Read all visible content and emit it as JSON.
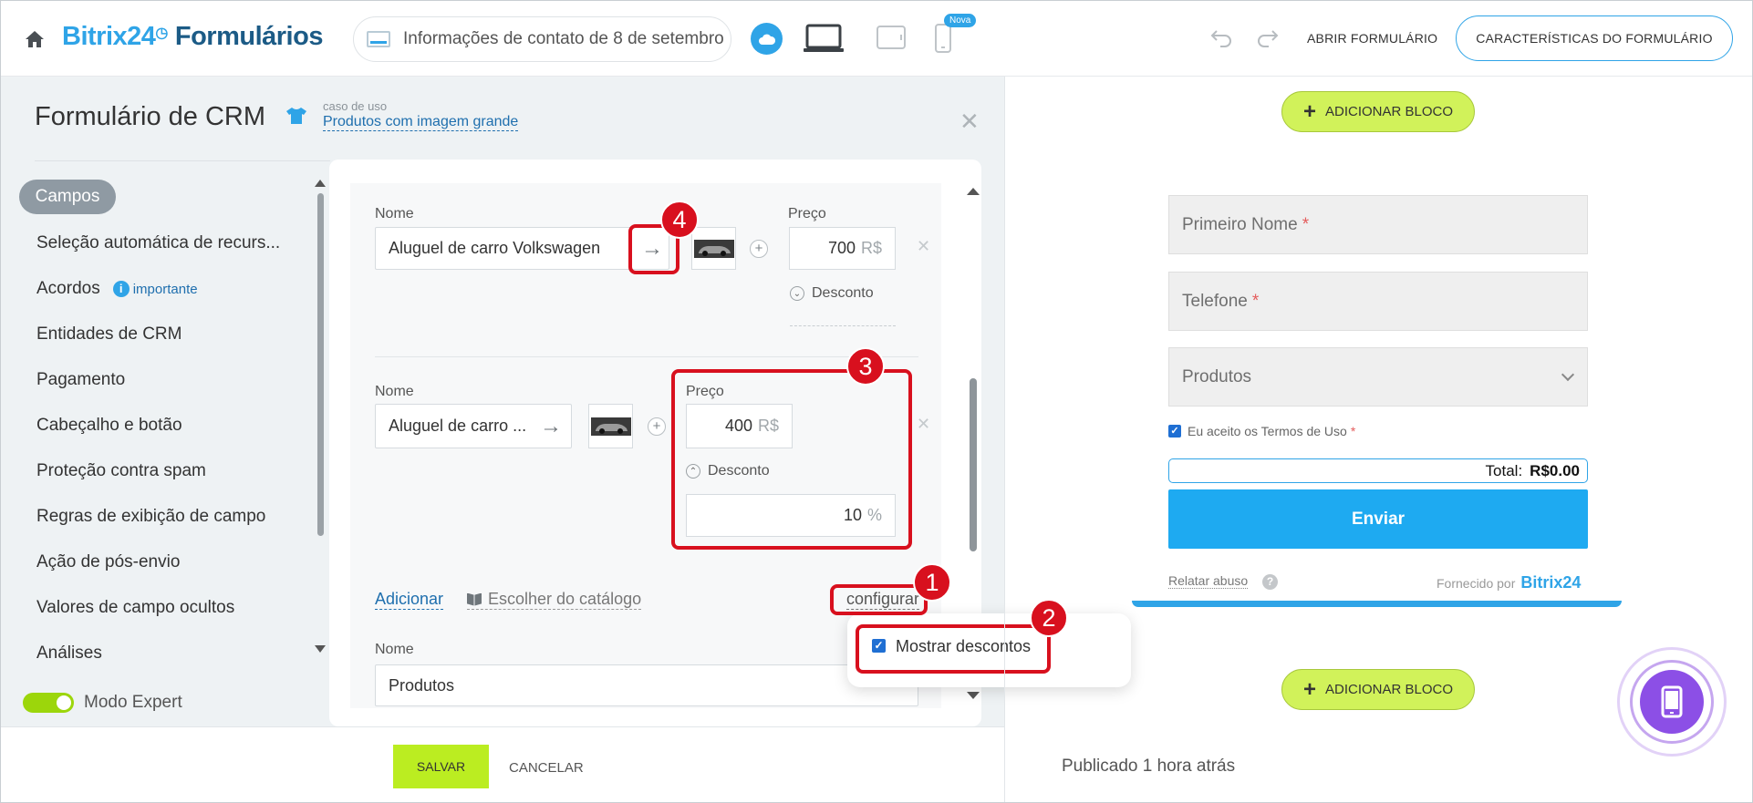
{
  "header": {
    "logo_brand": "Bitrix24",
    "logo_product": "Formulários",
    "form_selector": "Informações de contato de 8 de setembro",
    "nova_badge": "Nova",
    "abrir_formulario": "ABRIR FORMULÁRIO",
    "caracteristicas": "CARACTERÍSTICAS DO FORMULÁRIO",
    "icons": [
      "home-icon",
      "cloud-icon",
      "desktop-icon",
      "tablet-icon",
      "phone-icon",
      "undo-icon",
      "redo-icon"
    ]
  },
  "panel": {
    "title": "Formulário de CRM",
    "use_case_caption": "caso de uso",
    "use_case_link": "Produtos com imagem grande"
  },
  "nav": {
    "items": [
      {
        "label": "Campos",
        "active": true
      },
      {
        "label": "Seleção automática de recurs..."
      },
      {
        "label": "Acordos",
        "badge": "importante"
      },
      {
        "label": "Entidades de CRM"
      },
      {
        "label": "Pagamento"
      },
      {
        "label": "Cabeçalho e botão"
      },
      {
        "label": "Proteção contra spam"
      },
      {
        "label": "Regras de exibição de campo"
      },
      {
        "label": "Ação de pós-envio"
      },
      {
        "label": "Valores de campo ocultos"
      },
      {
        "label": "Análises"
      }
    ],
    "expert_mode": "Modo Expert",
    "expert_mode_on": true
  },
  "editor": {
    "product1": {
      "name_label": "Nome",
      "name_value": "Aluguel de carro Volkswagen",
      "price_label": "Preço",
      "price": "700",
      "currency": "R$",
      "discount_label": "Desconto"
    },
    "product2": {
      "name_label": "Nome",
      "name_value": "Aluguel de carro ...",
      "price_label": "Preço",
      "price": "400",
      "currency": "R$",
      "discount_label": "Desconto",
      "discount_value": "10",
      "discount_unit": "%"
    },
    "adicionar": "Adicionar",
    "catalogo": "Escolher do catálogo",
    "configurar": "configurar",
    "popup_option": "Mostrar descontos",
    "popup_checked": true,
    "field_name_label": "Nome",
    "field_name_value": "Produtos"
  },
  "callouts": [
    "1",
    "2",
    "3",
    "4"
  ],
  "footer": {
    "salvar": "SALVAR",
    "cancelar": "CANCELAR"
  },
  "preview": {
    "add_block": "ADICIONAR BLOCO",
    "field_first_name": "Primeiro Nome",
    "field_phone": "Telefone",
    "field_products": "Produtos",
    "required_mark": "*",
    "terms": "Eu aceito os Termos de Uso",
    "total_label": "Total:",
    "total_value": "R$0.00",
    "submit": "Enviar",
    "report_abuse": "Relatar abuso",
    "powered_by": "Fornecido por",
    "powered_brand": "Bitrix24",
    "published": "Publicado 1 hora atrás"
  },
  "colors": {
    "brand_blue": "#2fa4e7",
    "save_green": "#bbed21",
    "add_block_green": "#d1f25a",
    "callout_red": "#d8101e",
    "fab_purple": "#8c4fe6"
  }
}
